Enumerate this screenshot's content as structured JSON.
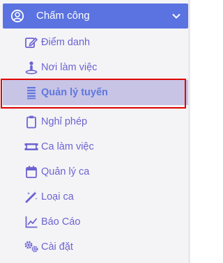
{
  "menu": {
    "header": {
      "title": "Chấm công",
      "icon": "user-circle-icon",
      "expand_icon": "chevron-down-icon"
    },
    "items": [
      {
        "label": "Điểm danh",
        "icon": "edit-icon"
      },
      {
        "label": "Nơi làm việc",
        "icon": "location-person-icon"
      },
      {
        "label": "Quản lý tuyến",
        "icon": "list-lines-icon",
        "selected": true
      },
      {
        "label": "Nghỉ phép",
        "icon": "clipboard-icon"
      },
      {
        "label": "Ca làm việc",
        "icon": "ticket-icon"
      },
      {
        "label": "Quản lý ca",
        "icon": "calendar-icon"
      },
      {
        "label": "Loại ca",
        "icon": "magic-wand-icon"
      },
      {
        "label": "Báo Cáo",
        "icon": "line-chart-icon"
      },
      {
        "label": "Cài đặt",
        "icon": "gears-icon"
      }
    ]
  },
  "colors": {
    "header_bg": "#5b73e0",
    "item_text": "#6c63d2",
    "selected_bg": "#c7c4e6",
    "selected_outline": "#e00000"
  }
}
